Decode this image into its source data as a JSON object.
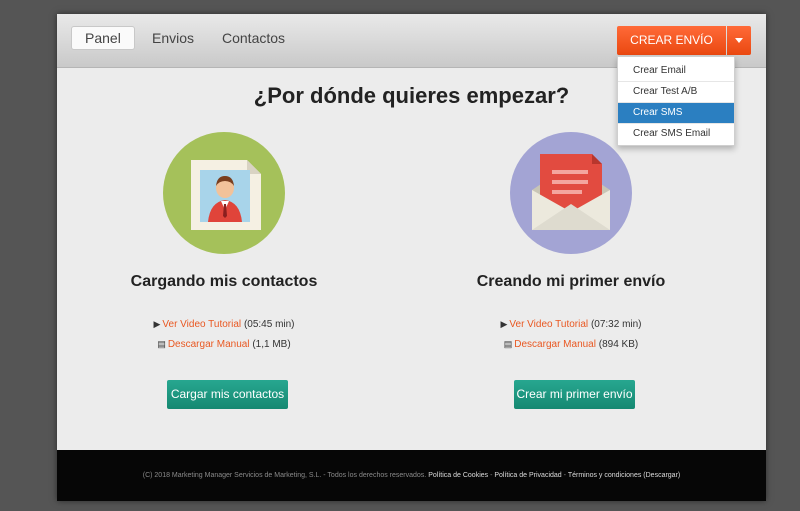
{
  "nav": {
    "items": [
      {
        "label": "Panel",
        "active": true
      },
      {
        "label": "Envios",
        "active": false
      },
      {
        "label": "Contactos",
        "active": false
      }
    ]
  },
  "create": {
    "label": "CREAR ENVÍO",
    "menu": [
      {
        "label": "Crear Email",
        "selected": false
      },
      {
        "label": "Crear Test A/B",
        "selected": false
      },
      {
        "label": "Crear SMS",
        "selected": true
      },
      {
        "label": "Crear SMS Email",
        "selected": false
      }
    ]
  },
  "main": {
    "heading": "¿Por dónde quieres empezar?",
    "left": {
      "title": "Cargando mis contactos",
      "video_link": "Ver Video Tutorial",
      "video_meta": "(05:45 min)",
      "manual_link": "Descargar Manual",
      "manual_meta": "(1,1 MB)",
      "button": "Cargar mis contactos"
    },
    "right": {
      "title": "Creando mi primer envío",
      "video_link": "Ver Video Tutorial",
      "video_meta": "(07:32 min)",
      "manual_link": "Descargar Manual",
      "manual_meta": "(894 KB)",
      "button": "Crear mi primer envío"
    }
  },
  "footer": {
    "copyright": "(C) 2018 Marketing Manager Servicios de Marketing, S.L. - Todos los derechos reservados.",
    "cookies": "Política de Cookies",
    "sep": " - ",
    "privacy": "Política de Privacidad",
    "terms": "Términos y condiciones (Descargar)"
  },
  "colors": {
    "accent": "#ea4810",
    "teal": "#158871",
    "selected": "#2b7fc1"
  }
}
